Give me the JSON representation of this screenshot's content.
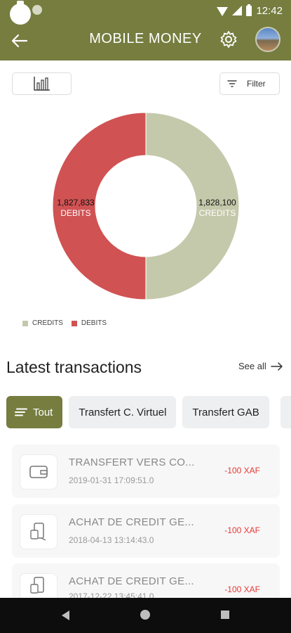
{
  "status_bar": {
    "time": "12:42"
  },
  "app_bar": {
    "title": "MOBILE MONEY"
  },
  "controls": {
    "filter_label": "Filter"
  },
  "chart_data": {
    "type": "pie",
    "donut": true,
    "categories": [
      "CREDITS",
      "DEBITS"
    ],
    "values": [
      1828100,
      1827833
    ],
    "value_labels": [
      "1,828,100",
      "1,827,833"
    ],
    "colors": [
      "#c5c9ab",
      "#d05253"
    ],
    "legend_position": "bottom-left"
  },
  "transactions_section": {
    "title": "Latest transactions",
    "see_all_label": "See all"
  },
  "chips": [
    {
      "label": "Tout",
      "active": true
    },
    {
      "label": "Transfert C. Virtuel",
      "active": false
    },
    {
      "label": "Transfert GAB",
      "active": false
    }
  ],
  "transactions": [
    {
      "title": "TRANSFERT VERS CO...",
      "date": "2019-01-31 17:09:51.0",
      "amount": "-100 XAF",
      "icon": "wallet-icon"
    },
    {
      "title": "ACHAT DE CREDIT GE...",
      "date": "2018-04-13 13:14:43.0",
      "amount": "-100 XAF",
      "icon": "phone-credit-icon"
    },
    {
      "title": "ACHAT DE CREDIT GE...",
      "date": "2017-12-22 13:45:41.0",
      "amount": "-100 XAF",
      "icon": "phone-credit-icon"
    }
  ],
  "colors": {
    "brand": "#767d3f",
    "credits": "#c5c9ab",
    "debits": "#d05253",
    "amount_negative": "#e53935"
  }
}
